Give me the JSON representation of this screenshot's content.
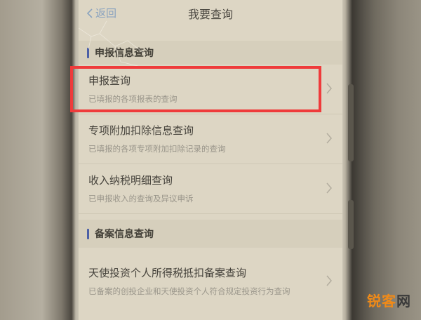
{
  "nav": {
    "back_label": "返回",
    "title": "我要查询"
  },
  "sections": [
    {
      "label": "申报信息查询",
      "items": [
        {
          "title": "申报查询",
          "subtitle": "已填报的各项报表的查询"
        },
        {
          "title": "专项附加扣除信息查询",
          "subtitle": "已填报的各项专项附加扣除记录的查询"
        },
        {
          "title": "收入纳税明细查询",
          "subtitle": "已申报收入的查询及异议申诉"
        }
      ]
    },
    {
      "label": "备案信息查询",
      "items": [
        {
          "title": "天使投资个人所得税抵扣备案查询",
          "subtitle": "已备案的创投企业和天使投资个人符合规定投资行为查询"
        }
      ]
    }
  ],
  "watermark": {
    "text_main": "锐客",
    "text_end": "网"
  },
  "colors": {
    "highlight": "#ef3b3b",
    "section_bar": "#4b5fa6",
    "back_link": "#8aa3bf",
    "watermark": "#f08a18"
  }
}
